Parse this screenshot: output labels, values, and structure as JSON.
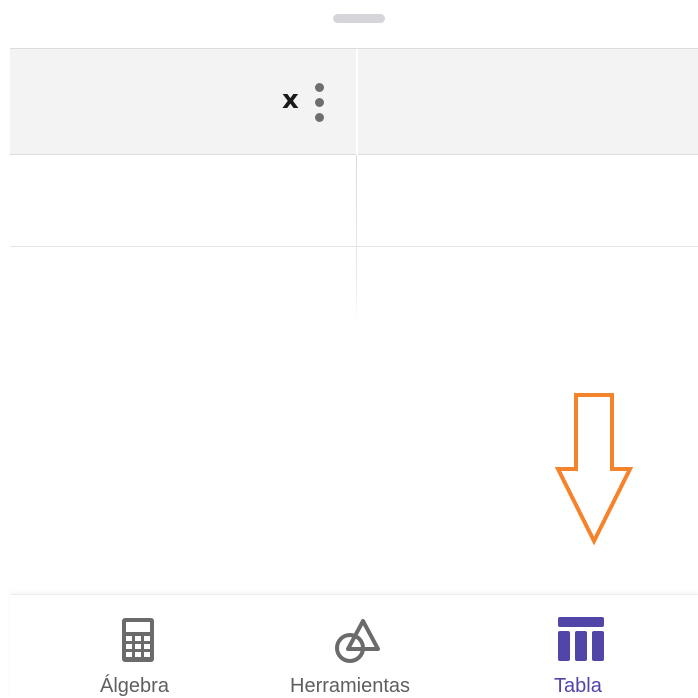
{
  "table": {
    "column_header": "x",
    "column_menu_icon": "more-vertical-icon"
  },
  "annotation": {
    "icon": "arrow-down-outline-icon",
    "color": "#f5832b"
  },
  "bottom_nav": {
    "items": [
      {
        "label": "Álgebra",
        "icon": "calculator-icon",
        "active": false
      },
      {
        "label": "Herramientas",
        "icon": "shapes-tool-icon",
        "active": false
      },
      {
        "label": "Tabla",
        "icon": "table-icon",
        "active": true
      }
    ],
    "active_color": "#5145a8",
    "inactive_color": "#5f5f5f"
  }
}
